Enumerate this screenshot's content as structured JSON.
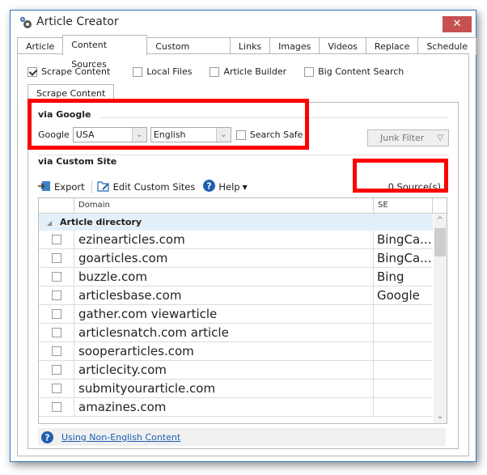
{
  "window": {
    "title": "Article Creator",
    "close_label": "✕"
  },
  "tabs": [
    {
      "label": "Article",
      "active": false
    },
    {
      "label": "Content Sources",
      "active": true
    },
    {
      "label": "Custom Content",
      "active": false
    },
    {
      "label": "Links",
      "active": false
    },
    {
      "label": "Images",
      "active": false
    },
    {
      "label": "Videos",
      "active": false
    },
    {
      "label": "Replace",
      "active": false
    },
    {
      "label": "Schedule",
      "active": false
    }
  ],
  "source_options": [
    {
      "label": "Scrape Content",
      "checked": true
    },
    {
      "label": "Local Files",
      "checked": false
    },
    {
      "label": "Article Builder",
      "checked": false
    },
    {
      "label": "Big Content Search",
      "checked": false
    }
  ],
  "subtab": {
    "label": "Scrape Content"
  },
  "via_google": {
    "heading": "via Google",
    "google_label": "Google",
    "country": "USA",
    "language": "English",
    "search_safe_label": "Search Safe",
    "search_safe_checked": false,
    "junk_filter_label": "Junk Filter"
  },
  "via_custom": {
    "heading": "via Custom Site",
    "export_label": "Export",
    "edit_label": "Edit Custom Sites",
    "help_label": "Help",
    "sources_count": "0 Source(s)"
  },
  "grid": {
    "columns": [
      "",
      "Domain",
      "SE"
    ],
    "group": "Article directory",
    "rows": [
      {
        "domain": "ezinearticles.com",
        "se": "BingCa...",
        "checked": false
      },
      {
        "domain": "goarticles.com",
        "se": "BingCa...",
        "checked": false
      },
      {
        "domain": "buzzle.com",
        "se": "Bing",
        "checked": false
      },
      {
        "domain": "articlesbase.com",
        "se": "Google",
        "checked": false
      },
      {
        "domain": "gather.com viewarticle",
        "se": "",
        "checked": false
      },
      {
        "domain": "articlesnatch.com article",
        "se": "",
        "checked": false
      },
      {
        "domain": "sooperarticles.com",
        "se": "",
        "checked": false
      },
      {
        "domain": "articlecity.com",
        "se": "",
        "checked": false
      },
      {
        "domain": "submityourarticle.com",
        "se": "",
        "checked": false
      },
      {
        "domain": "amazines.com",
        "se": "",
        "checked": false
      }
    ]
  },
  "footer": {
    "link_label": "Using Non-English Content"
  },
  "colors": {
    "highlight": "#ff0000",
    "close": "#c75050",
    "link": "#1a5fb4",
    "group_bg": "#e4f0f9"
  }
}
